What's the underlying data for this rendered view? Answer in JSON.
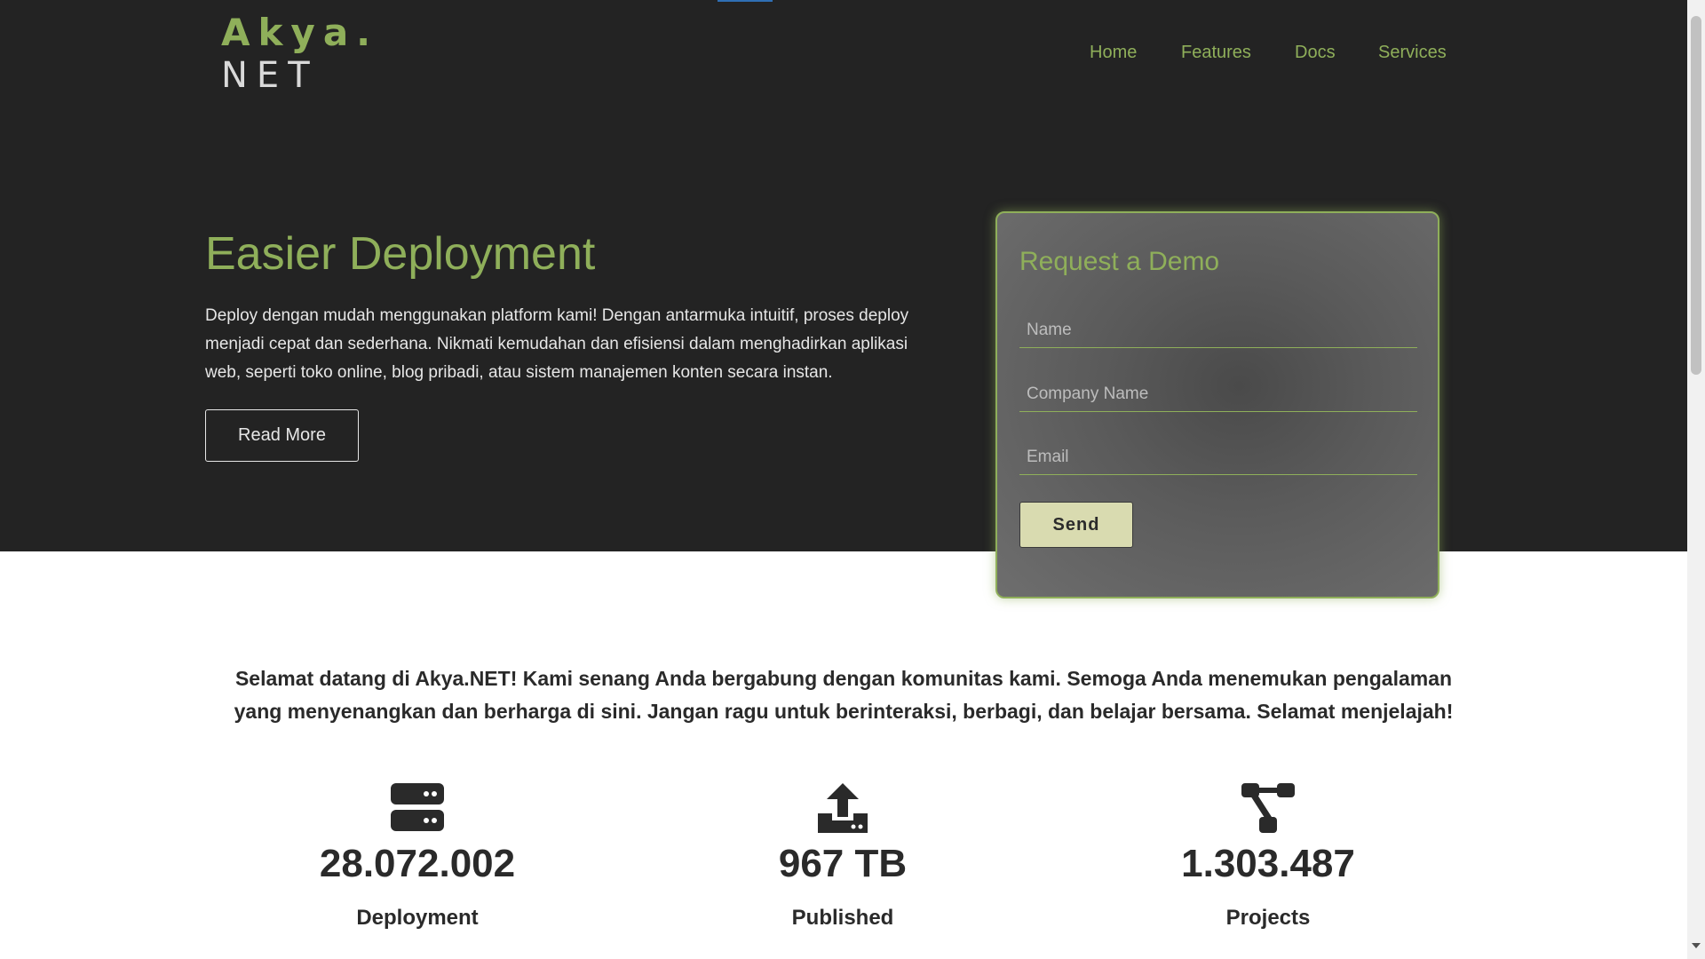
{
  "brand": {
    "logo_top": "Akya.",
    "logo_bottom": "NET"
  },
  "nav": {
    "items": [
      "Home",
      "Features",
      "Docs",
      "Services"
    ]
  },
  "hero": {
    "title": "Easier Deployment",
    "text": "Deploy dengan mudah menggunakan platform kami! Dengan antarmuka intuitif, proses deploy menjadi cepat dan sederhana. Nikmati kemudahan dan efisiensi dalam menghadirkan aplikasi web, seperti toko online, blog pribadi, atau sistem manajemen konten secara instan.",
    "button_label": "Read More"
  },
  "demo_form": {
    "title": "Request a Demo",
    "name_placeholder": "Name",
    "company_placeholder": "Company Name",
    "email_placeholder": "Email",
    "send_label": "Send"
  },
  "welcome_text": "Selamat datang di Akya.NET! Kami senang Anda bergabung dengan komunitas kami. Semoga Anda menemukan pengalaman yang menyenangkan dan berharga di sini. Jangan ragu untuk berinteraksi, berbagi, dan belajar bersama. Selamat menjelajah!",
  "stats": [
    {
      "icon": "server-icon",
      "value": "28.072.002",
      "label": "Deployment"
    },
    {
      "icon": "upload-icon",
      "value": "967 TB",
      "label": "Published"
    },
    {
      "icon": "diagram-icon",
      "value": "1.303.487",
      "label": "Projects"
    }
  ],
  "colors": {
    "accent_green": "#8faf5a",
    "hero_background": "#232323",
    "send_button": "#d9dbb0",
    "top_accent": "#2f6fb4"
  }
}
